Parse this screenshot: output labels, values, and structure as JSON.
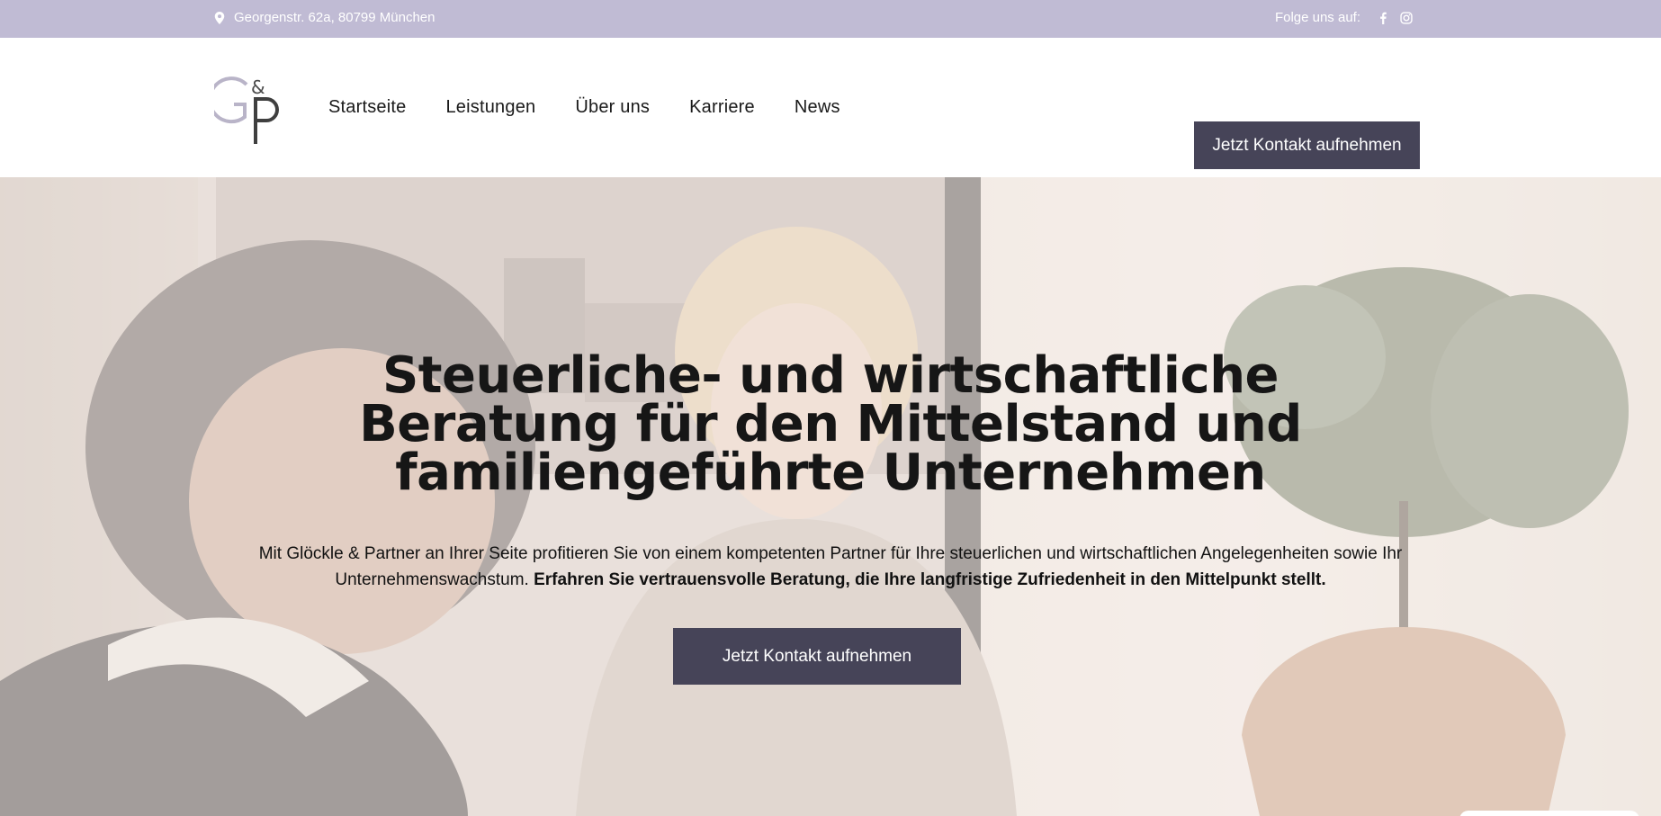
{
  "topbar": {
    "address": "Georgenstr. 62a, 80799 München",
    "follow_label": "Folge uns auf:",
    "icons": [
      "map-pin-icon",
      "facebook-icon",
      "instagram-icon"
    ]
  },
  "header": {
    "logo_alt": "G&P",
    "nav": [
      "Startseite",
      "Leistungen",
      "Über uns",
      "Karriere",
      "News"
    ],
    "cta_label": "Jetzt Kontakt aufnehmen"
  },
  "hero": {
    "title_lines": [
      "Steuerliche- und wirtschaftliche",
      "Beratung für den Mittelstand und",
      "familiengeführte Unternehmen"
    ],
    "text_regular": "Mit Glöckle & Partner an Ihrer Seite profitieren Sie von einem kompetenten Partner für Ihre steuerlichen und wirtschaftlichen Angelegenheiten sowie Ihr Unternehmenswachstum.",
    "text_bold": "Erfahren Sie vertrauensvolle Beratung, die Ihre langfristige Zufriedenheit in den Mittelpunkt stellt.",
    "cta_label": "Jetzt Kontakt aufnehmen"
  },
  "colors": {
    "topbar_bg": "#c0bbd4",
    "button_bg": "#464458",
    "text": "#161616"
  }
}
